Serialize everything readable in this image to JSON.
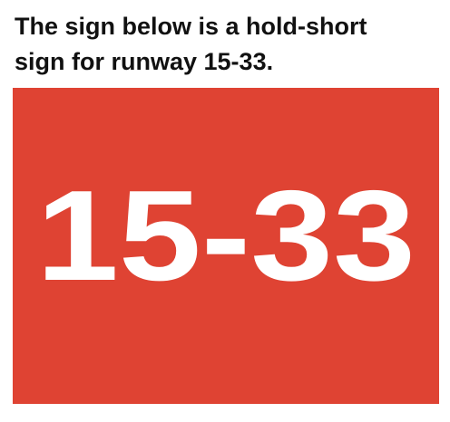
{
  "caption": {
    "line1": "The sign below is a hold-short",
    "line2": "sign for runway 15-33."
  },
  "sign": {
    "text": "15-33",
    "background_color": "#df4333",
    "text_color": "#ffffff"
  }
}
